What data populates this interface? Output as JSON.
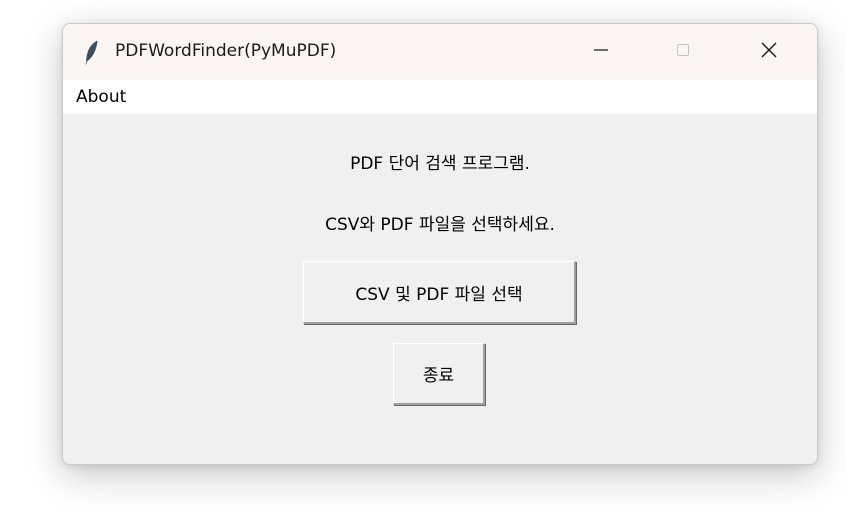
{
  "window": {
    "title": "PDFWordFinder(PyMuPDF)"
  },
  "menubar": {
    "items": [
      {
        "label": "About"
      }
    ]
  },
  "main": {
    "line1": "PDF 단어 검색 프로그램.",
    "line2": "CSV와 PDF 파일을 선택하세요.",
    "select_button_label": "CSV 및 PDF 파일 선택",
    "quit_button_label": "종료"
  },
  "icons": {
    "app": "feather-icon",
    "minimize": "minimize-icon",
    "maximize": "maximize-icon",
    "close": "close-icon"
  },
  "colors": {
    "titlebar_bg": "#fbf5f3",
    "window_bg": "#f0f0f0",
    "menubar_bg": "#ffffff",
    "icon_feather": "#3b4f63"
  }
}
